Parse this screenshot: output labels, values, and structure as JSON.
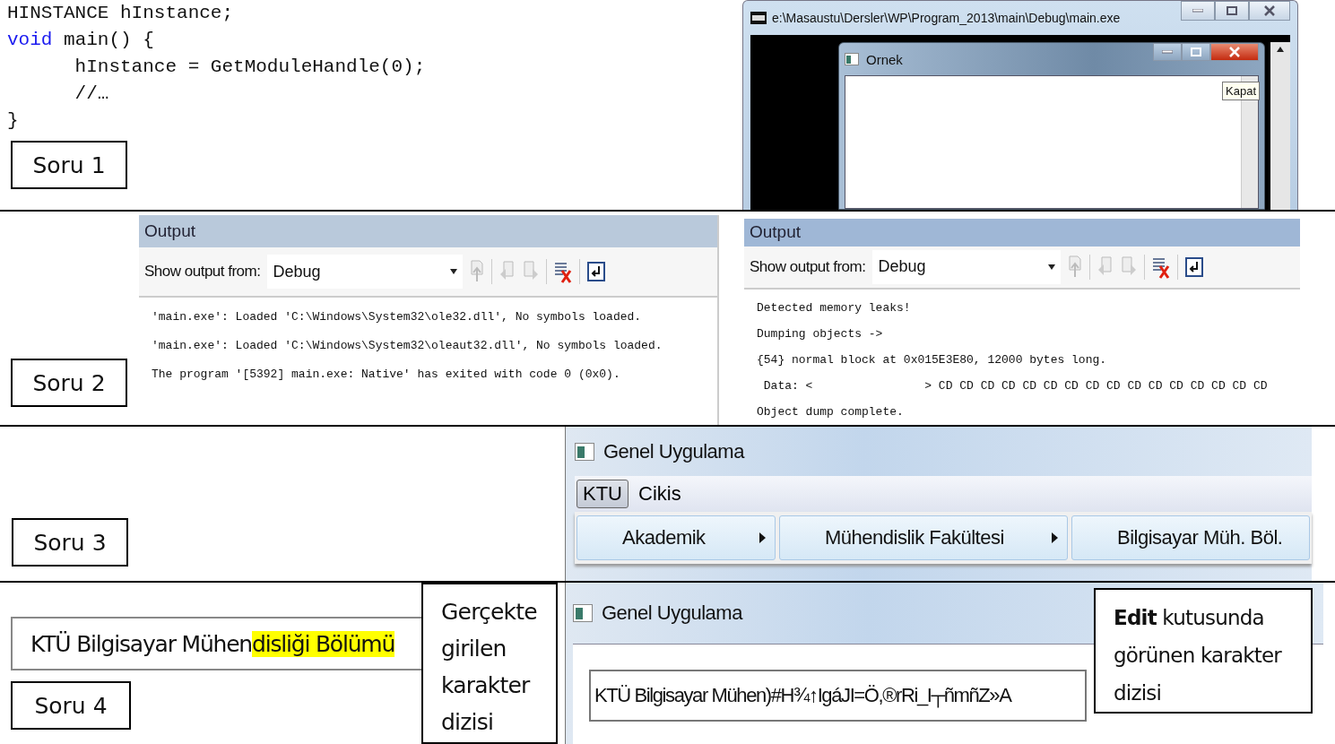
{
  "q1": {
    "label": "Soru 1",
    "code": [
      {
        "parts": [
          {
            "kind": "plain",
            "text": "HINSTANCE hInstance;"
          }
        ]
      },
      {
        "parts": [
          {
            "kind": "keyword",
            "text": "void"
          },
          {
            "kind": "plain",
            "text": " main() {"
          }
        ]
      },
      {
        "parts": [
          {
            "kind": "plain",
            "text": "      hInstance = GetModuleHandle(0);"
          }
        ]
      },
      {
        "parts": [
          {
            "kind": "plain",
            "text": "      //…"
          }
        ]
      },
      {
        "parts": [
          {
            "kind": "plain",
            "text": "}"
          }
        ]
      }
    ],
    "console_window": {
      "title": "e:\\Masaustu\\Dersler\\WP\\Program_2013\\main\\Debug\\main.exe",
      "inner_window": {
        "title": "Ornek"
      },
      "tooltip": "Kapat"
    }
  },
  "q2": {
    "label": "Soru 2",
    "panels": [
      {
        "title": "Output",
        "show_label": "Show output from:",
        "source": "Debug",
        "lines": [
          "'main.exe': Loaded 'C:\\Windows\\System32\\ole32.dll', No symbols loaded.",
          "'main.exe': Loaded 'C:\\Windows\\System32\\oleaut32.dll', No symbols loaded.",
          "The program '[5392] main.exe: Native' has exited with code 0 (0x0)."
        ]
      },
      {
        "title": "Output",
        "show_label": "Show output from:",
        "source": "Debug",
        "lines": [
          "Detected memory leaks!",
          "Dumping objects ->",
          "{54} normal block at 0x015E3E80, 12000 bytes long.",
          " Data: <                > CD CD CD CD CD CD CD CD CD CD CD CD CD CD CD CD",
          "Object dump complete."
        ]
      }
    ]
  },
  "q3": {
    "label": "Soru 3",
    "window": {
      "title": "Genel Uygulama",
      "menu": [
        {
          "label": "KTU",
          "selected": true
        },
        {
          "label": "Cikis",
          "selected": false
        }
      ],
      "submenus": [
        {
          "label": "Akademik",
          "has_submenu": true
        },
        {
          "label": "Mühendislik Fakültesi",
          "has_submenu": true
        },
        {
          "label": "Bilgisayar Müh. Böl.",
          "has_submenu": false
        }
      ]
    }
  },
  "q4": {
    "label": "Soru 4",
    "typed_plain": "KTÜ Bilgisayar Mühen",
    "typed_highlight": "disliği Bölümü",
    "left_note": "Gerçekte girilen karakter dizisi",
    "window": {
      "title": "Genel Uygulama",
      "edit_value": "KTÜ Bilgisayar Mühen)#H¾↑IgáJI=Ö,®rRi_I┬ñmñZ»A"
    },
    "right_note": "**Edit** kutusunda görünen karakter dizisi"
  }
}
